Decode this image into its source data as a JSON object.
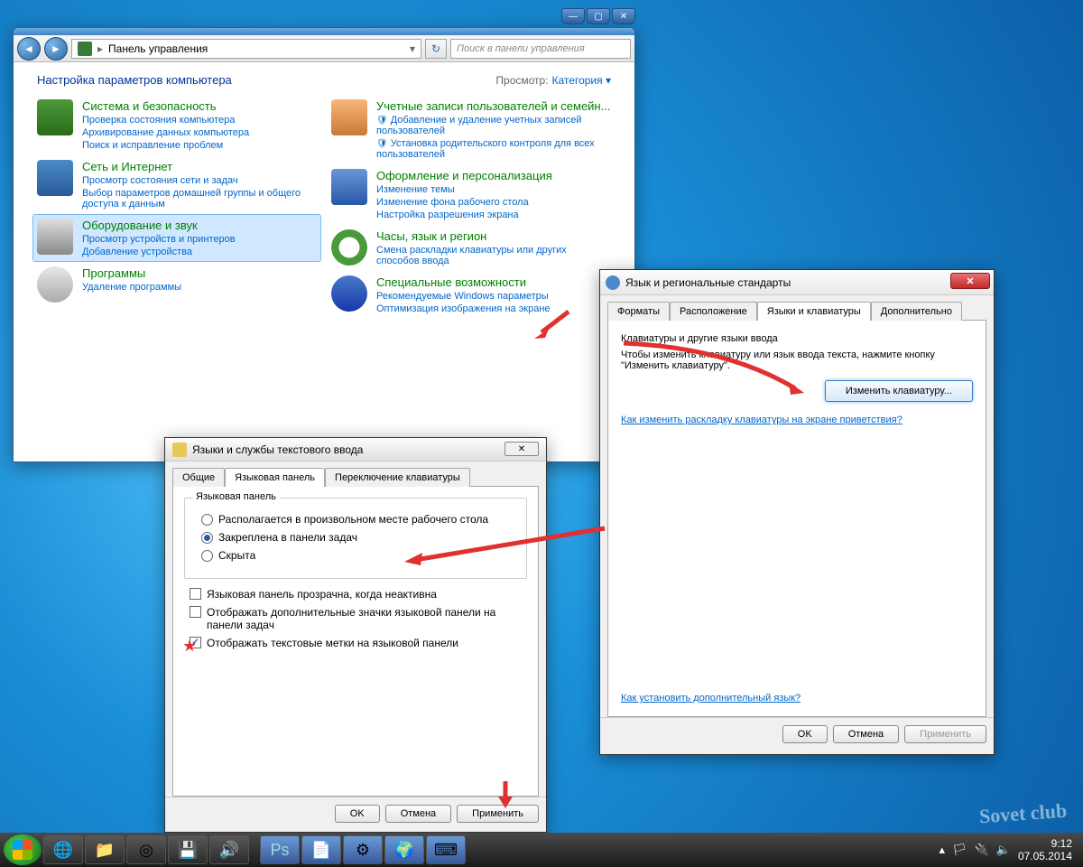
{
  "control_panel": {
    "breadcrumb": "Панель управления",
    "search_placeholder": "Поиск в панели управления",
    "heading": "Настройка параметров компьютера",
    "viewby_label": "Просмотр:",
    "viewby_value": "Категория",
    "categories_left": [
      {
        "title": "Система и безопасность",
        "links": [
          "Проверка состояния компьютера",
          "Архивирование данных компьютера",
          "Поиск и исправление проблем"
        ]
      },
      {
        "title": "Сеть и Интернет",
        "links": [
          "Просмотр состояния сети и задач",
          "Выбор параметров домашней группы и общего доступа к данным"
        ]
      },
      {
        "title": "Оборудование и звук",
        "links": [
          "Просмотр устройств и принтеров",
          "Добавление устройства"
        ],
        "selected": true
      },
      {
        "title": "Программы",
        "links": [
          "Удаление программы"
        ]
      }
    ],
    "categories_right": [
      {
        "title": "Учетные записи пользователей и семейн...",
        "links": [
          "Добавление и удаление учетных записей пользователей",
          "Установка родительского контроля для всех пользователей"
        ],
        "shield": true
      },
      {
        "title": "Оформление и персонализация",
        "links": [
          "Изменение темы",
          "Изменение фона рабочего стола",
          "Настройка разрешения экрана"
        ]
      },
      {
        "title": "Часы, язык и регион",
        "links": [
          "Смена раскладки клавиатуры или других способов ввода"
        ]
      },
      {
        "title": "Специальные возможности",
        "links": [
          "Рекомендуемые Windows параметры",
          "Оптимизация изображения на экране"
        ]
      }
    ]
  },
  "region_dialog": {
    "title": "Язык и региональные стандарты",
    "tabs": [
      "Форматы",
      "Расположение",
      "Языки и клавиатуры",
      "Дополнительно"
    ],
    "active_tab": 2,
    "group_title": "Клавиатуры и другие языки ввода",
    "help_text": "Чтобы изменить клавиатуру или язык ввода текста, нажмите кнопку \"Изменить клавиатуру\".",
    "change_kb_btn": "Изменить клавиатуру...",
    "welcome_link": "Как изменить раскладку клавиатуры на экране приветствия?",
    "install_link": "Как установить дополнительный язык?",
    "buttons": {
      "ok": "OK",
      "cancel": "Отмена",
      "apply": "Применить"
    }
  },
  "textsvc_dialog": {
    "title": "Языки и службы текстового ввода",
    "tabs": [
      "Общие",
      "Языковая панель",
      "Переключение клавиатуры"
    ],
    "active_tab": 1,
    "group": "Языковая панель",
    "radios": [
      {
        "label": "Располагается в произвольном месте рабочего стола",
        "checked": false
      },
      {
        "label": "Закреплена в панели задач",
        "checked": true
      },
      {
        "label": "Скрыта",
        "checked": false
      }
    ],
    "checks": [
      {
        "label": "Языковая панель прозрачна, когда неактивна",
        "checked": false
      },
      {
        "label": "Отображать дополнительные значки языковой панели на панели задач",
        "checked": false
      },
      {
        "label": "Отображать текстовые метки на языковой панели",
        "checked": true,
        "star": true
      }
    ],
    "buttons": {
      "ok": "OK",
      "cancel": "Отмена",
      "apply": "Применить"
    }
  },
  "taskbar": {
    "time": "9:12",
    "date": "07.05.2014"
  },
  "watermark": "Sovet club"
}
